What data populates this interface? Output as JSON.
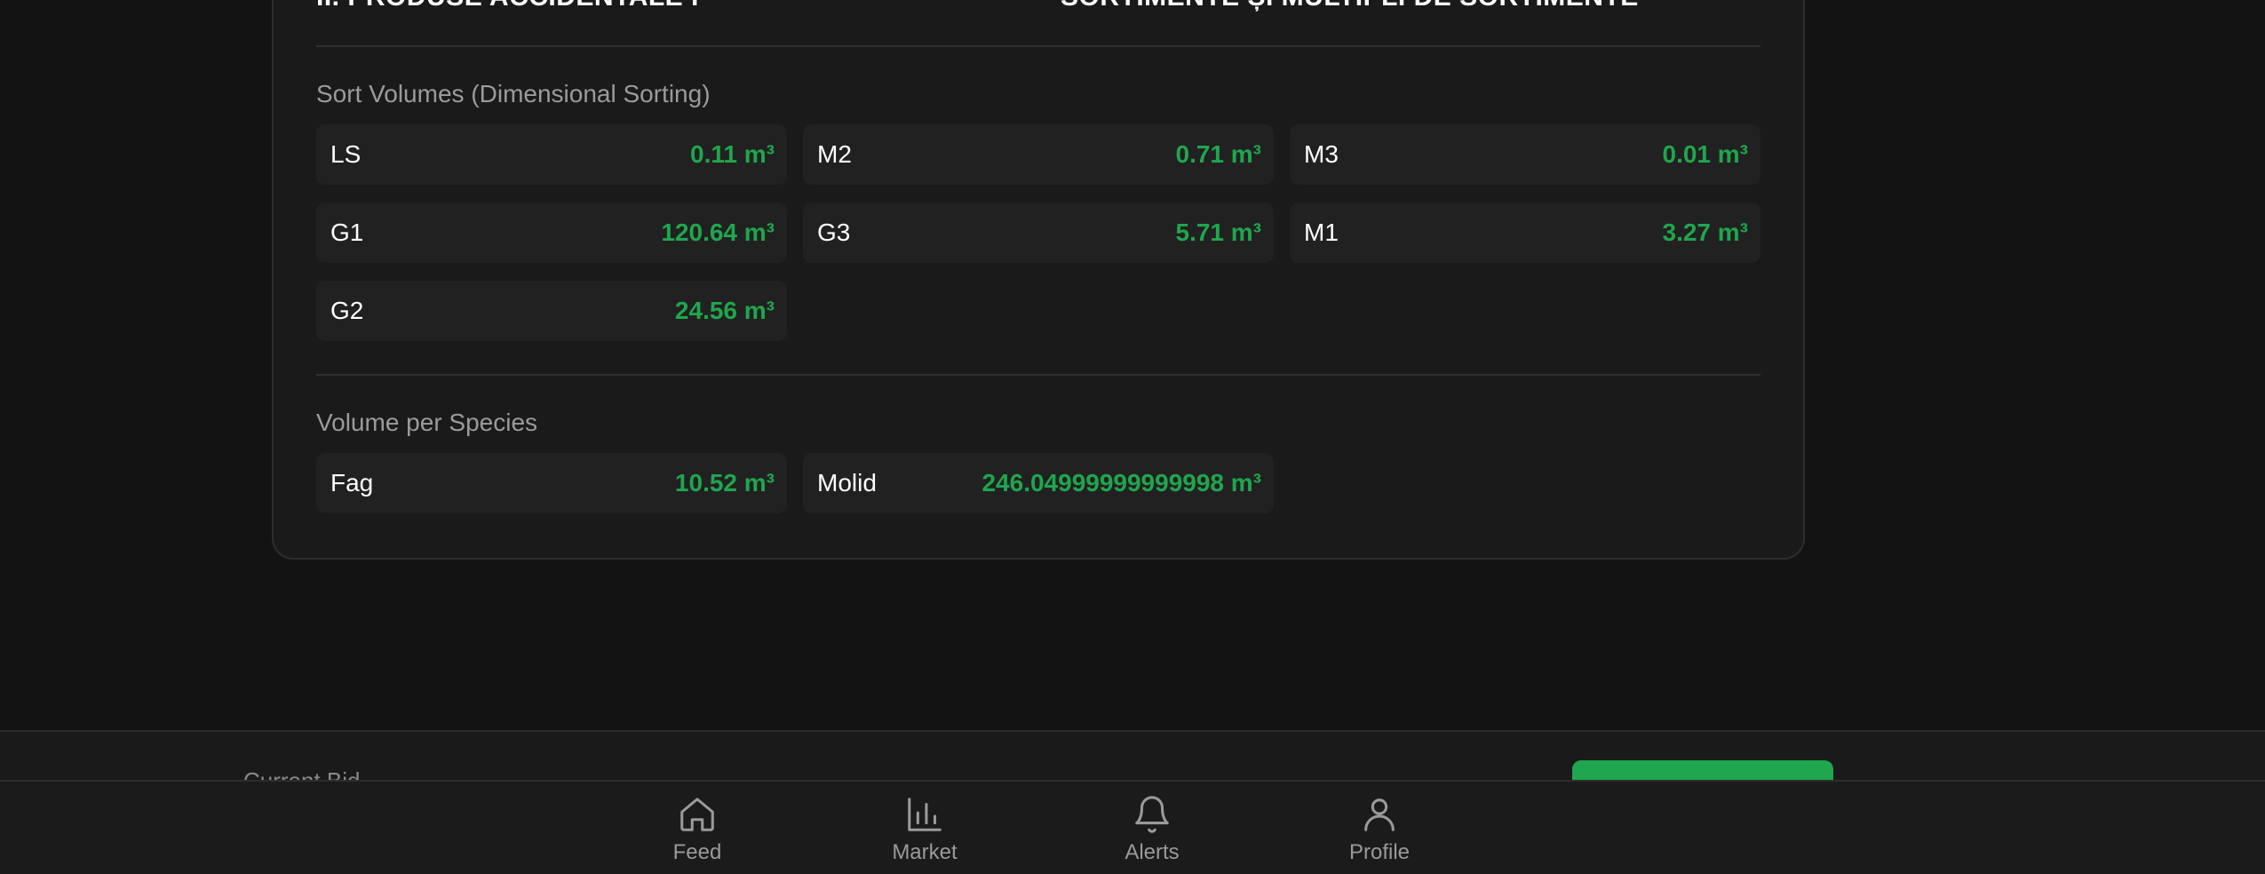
{
  "card": {
    "clipped_left_heading": "II. PRODUSE ACCIDENTALE I",
    "clipped_right_heading": "SORTIMENTE ȘI MULTIPLI DE SORTIMENTE",
    "sort_section": {
      "title": "Sort Volumes (Dimensional Sorting)",
      "tiles": [
        {
          "label": "LS",
          "value": "0.11 m³"
        },
        {
          "label": "M2",
          "value": "0.71 m³"
        },
        {
          "label": "M3",
          "value": "0.01 m³"
        },
        {
          "label": "G1",
          "value": "120.64 m³"
        },
        {
          "label": "G3",
          "value": "5.71 m³"
        },
        {
          "label": "M1",
          "value": "3.27 m³"
        },
        {
          "label": "G2",
          "value": "24.56 m³"
        }
      ]
    },
    "species_section": {
      "title": "Volume per Species",
      "tiles": [
        {
          "label": "Fag",
          "value": "10.52 m³"
        },
        {
          "label": "Molid",
          "value": "246.04999999999998 m³"
        }
      ]
    }
  },
  "bid_bar": {
    "label": "Current Bid",
    "accent_color": "#1fa64e"
  },
  "nav": {
    "items": [
      {
        "label": "Feed",
        "icon": "home-icon"
      },
      {
        "label": "Market",
        "icon": "bar-chart-icon"
      },
      {
        "label": "Alerts",
        "icon": "bell-icon"
      },
      {
        "label": "Profile",
        "icon": "user-icon"
      }
    ]
  },
  "colors": {
    "background": "#131313",
    "card": "#1a1a1a",
    "tile": "#212121",
    "value_green": "#1fa64e",
    "muted_text": "#9b9b9b"
  }
}
